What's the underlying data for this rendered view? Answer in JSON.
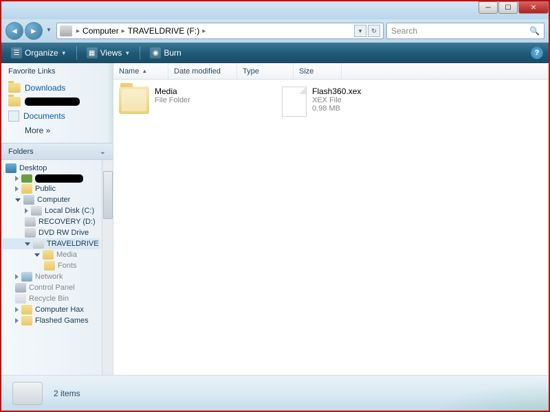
{
  "breadcrumb": {
    "items": [
      "Computer",
      "TRAVELDRIVE (F:)"
    ]
  },
  "search": {
    "placeholder": "Search"
  },
  "toolbar": {
    "organize": "Organize",
    "views": "Views",
    "burn": "Burn"
  },
  "favorites": {
    "header": "Favorite Links",
    "downloads": "Downloads",
    "documents": "Documents",
    "more": "More  »"
  },
  "folders": {
    "header": "Folders",
    "tree": {
      "desktop": "Desktop",
      "public": "Public",
      "computer": "Computer",
      "local": "Local Disk (C:)",
      "recovery": "RECOVERY (D:)",
      "dvd": "DVD RW Drive",
      "travel": "TRAVELDRIVE (",
      "media": "Media",
      "fonts": "Fonts",
      "network": "Network",
      "cpanel": "Control Panel",
      "recycle": "Recycle Bin",
      "hax": "Computer Hax",
      "flashed": "Flashed Games"
    }
  },
  "columns": {
    "name": "Name",
    "date": "Date modified",
    "type": "Type",
    "size": "Size"
  },
  "files": [
    {
      "name": "Media",
      "sub1": "File Folder",
      "sub2": ""
    },
    {
      "name": "Flash360.xex",
      "sub1": "XEX File",
      "sub2": "0.98 MB"
    }
  ],
  "status": {
    "text": "2 items"
  }
}
